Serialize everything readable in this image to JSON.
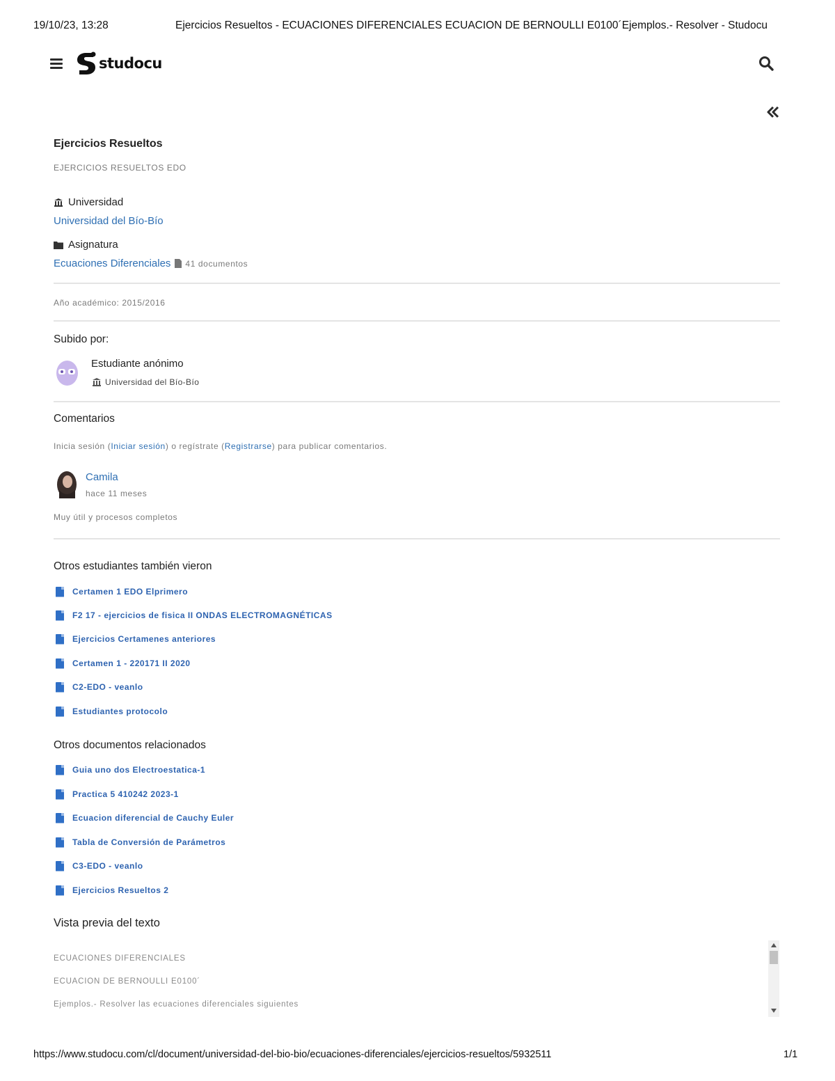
{
  "print_header": {
    "datetime": "19/10/23, 13:28",
    "title": "Ejercicios Resueltos - ECUACIONES DIFERENCIALES ECUACION DE BERNOULLI E0100´Ejemplos.- Resolver - Studocu"
  },
  "topbar": {
    "menu_icon": "hamburger-icon",
    "logo_text": "studocu",
    "search_icon": "search-icon",
    "collapse_icon": "double-chevron-left-icon"
  },
  "document": {
    "title": "Ejercicios Resueltos",
    "subtitle": "EJERCICIOS RESUELTOS EDO",
    "university_label": "Universidad",
    "university_name": "Universidad del Bío-Bío",
    "subject_label": "Asignatura",
    "subject_name": "Ecuaciones Diferenciales",
    "subject_docs": "41 documentos",
    "academic_year": "Año académico: 2015/2016"
  },
  "uploader": {
    "label": "Subido por:",
    "name": "Estudiante anónimo",
    "university": "Universidad del Bío-Bío"
  },
  "comments": {
    "title": "Comentarios",
    "prompt_before": "Inicia sesión (",
    "login_link": "Iniciar sesión",
    "prompt_middle": ") o regístrate (",
    "register_link": "Registrarse",
    "prompt_after": ") para publicar comentarios.",
    "items": [
      {
        "author": "Camila",
        "time": "hace 11 meses",
        "text": "Muy útil y procesos completos"
      }
    ]
  },
  "also_viewed": {
    "title": "Otros estudiantes también vieron",
    "items": [
      "Certamen 1 EDO Elprimero",
      "F2 17 - ejercicios de fisica II ONDAS ELECTROMAGNÉTICAS",
      "Ejercicios Certamenes anteriores",
      "Certamen 1 - 220171 II 2020",
      "C2-EDO - veanlo",
      "Estudiantes protocolo"
    ]
  },
  "related": {
    "title": "Otros documentos relacionados",
    "items": [
      "Guia uno dos Electroestatica-1",
      "Practica 5 410242 2023-1",
      "Ecuacion diferencial de Cauchy Euler",
      "Tabla de Conversión de Parámetros",
      "C3-EDO - veanlo",
      "Ejercicios Resueltos 2"
    ]
  },
  "preview": {
    "title": "Vista previa del texto",
    "lines": [
      "ECUACIONES DIFERENCIALES",
      "ECUACION DE BERNOULLI E0100´",
      "Ejemplos.- Resolver las ecuaciones diferenciales siguientes"
    ]
  },
  "print_footer": {
    "url": "https://www.studocu.com/cl/document/universidad-del-bio-bio/ecuaciones-diferenciales/ejercicios-resueltos/5932511",
    "page": "1/1"
  }
}
